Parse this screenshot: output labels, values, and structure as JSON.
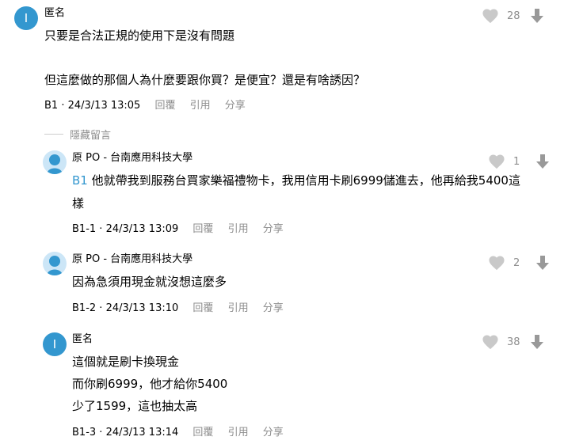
{
  "colors": {
    "accent": "#3397cf",
    "muted": "#8e8e8e",
    "avatar_letter_bg": "#3397cf",
    "avatar_school_bg": "#cce6f7"
  },
  "comments": [
    {
      "author": "匿名",
      "avatar_letter": "I",
      "lines": [
        "只要是合法正規的使用下是沒有問題",
        "",
        "但這麼做的那個人為什麼要跟你買？是便宜？還是有啥誘因？"
      ],
      "floor": "B1",
      "time": "24/3/13 13:05",
      "likes": "28"
    },
    {
      "author": "原 PO - 台南應用科技大學",
      "floor_ref": "B1",
      "lines": [
        "他就帶我到服務台買家樂福禮物卡，我用信用卡刷6999儲進去，他再給我5400這",
        "樣"
      ],
      "floor": "B1-1",
      "time": "24/3/13 13:09",
      "likes": "1"
    },
    {
      "author": "原 PO - 台南應用科技大學",
      "lines": [
        "因為急須用現金就沒想這麼多"
      ],
      "floor": "B1-2",
      "time": "24/3/13 13:10",
      "likes": "2"
    },
    {
      "author": "匿名",
      "avatar_letter": "I",
      "lines": [
        "這個就是刷卡換現金",
        "而你刷6999，他才給你5400",
        "少了1599，這也抽太高"
      ],
      "floor": "B1-3",
      "time": "24/3/13 13:14",
      "likes": "38"
    }
  ],
  "actions": {
    "reply": "回覆",
    "quote": "引用",
    "share": "分享"
  },
  "hidden_toggle": "隱藏留言",
  "icons": {
    "like": "heart-icon",
    "dislike": "arrow-down-icon"
  }
}
